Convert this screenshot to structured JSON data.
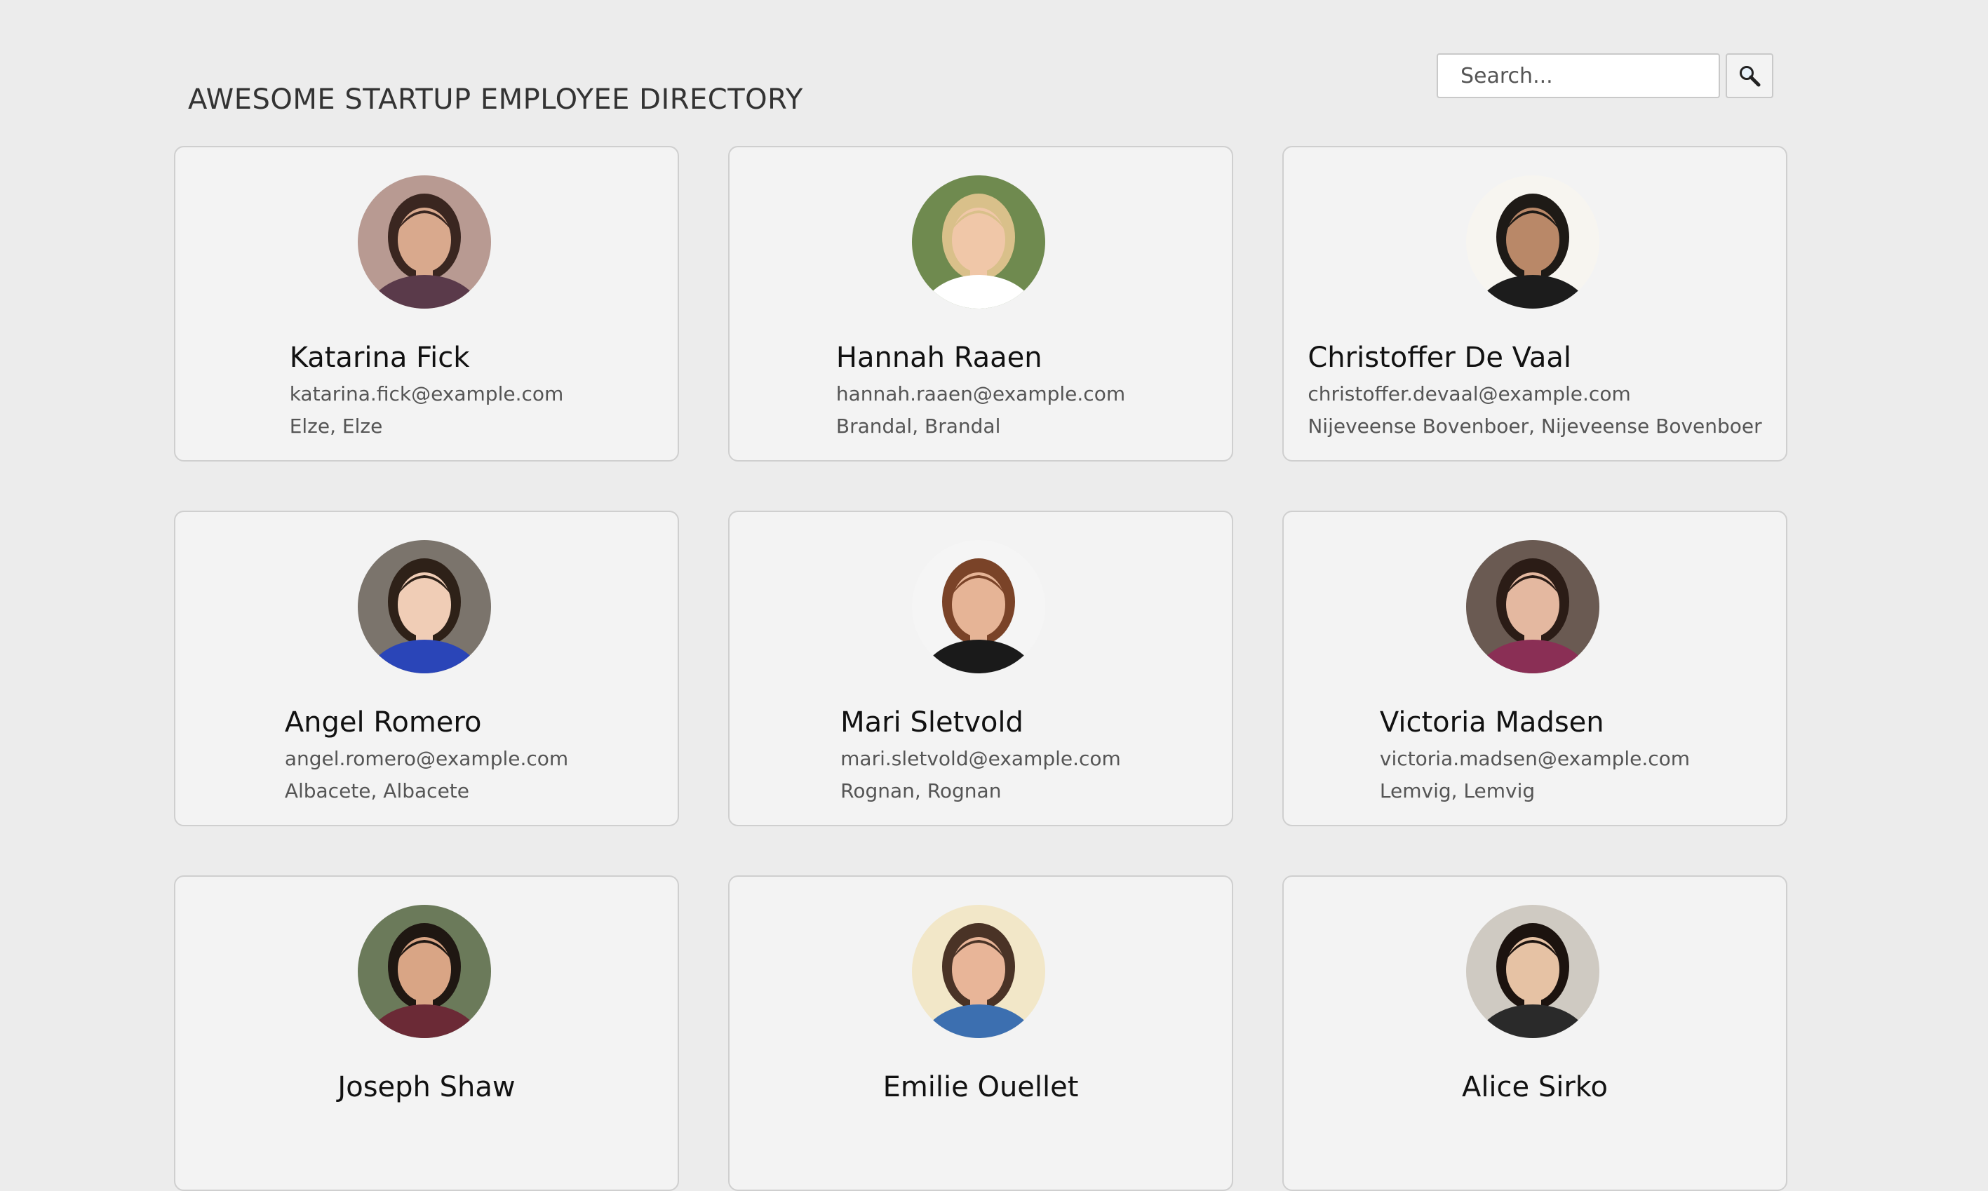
{
  "header": {
    "title": "AWESOME STARTUP EMPLOYEE DIRECTORY",
    "search_placeholder": "Search...",
    "search_icon": "magnifier-icon"
  },
  "employees": [
    {
      "name": "Katarina Fick",
      "email": "katarina.fick@example.com",
      "location": "Elze, Elze"
    },
    {
      "name": "Hannah Raaen",
      "email": "hannah.raaen@example.com",
      "location": "Brandal, Brandal"
    },
    {
      "name": "Christoffer De Vaal",
      "email": "christoffer.devaal@example.com",
      "location": "Nijeveense Bovenboer, Nijeveense Bovenboer"
    },
    {
      "name": "Angel Romero",
      "email": "angel.romero@example.com",
      "location": "Albacete, Albacete"
    },
    {
      "name": "Mari Sletvold",
      "email": "mari.sletvold@example.com",
      "location": "Rognan, Rognan"
    },
    {
      "name": "Victoria Madsen",
      "email": "victoria.madsen@example.com",
      "location": "Lemvig, Lemvig"
    },
    {
      "name": "Joseph Shaw",
      "email": "",
      "location": ""
    },
    {
      "name": "Emilie Ouellet",
      "email": "",
      "location": ""
    },
    {
      "name": "Alice Sirko",
      "email": "",
      "location": ""
    }
  ],
  "avatars": [
    {
      "bg": "#b89a92",
      "skin": "#d9a98d",
      "hair": "#3a2620",
      "shirt": "#5a3a4a"
    },
    {
      "bg": "#6f8a4f",
      "skin": "#f0c7a8",
      "hair": "#d9c08a",
      "shirt": "#ffffff"
    },
    {
      "bg": "#f7f5f0",
      "skin": "#b98868",
      "hair": "#1e1a16",
      "shirt": "#1c1c1c"
    },
    {
      "bg": "#7b746c",
      "skin": "#f0cdb6",
      "hair": "#2e2118",
      "shirt": "#2a45b8"
    },
    {
      "bg": "#f5f5f5",
      "skin": "#e6b496",
      "hair": "#7a4328",
      "shirt": "#1a1a1a"
    },
    {
      "bg": "#6a5a52",
      "skin": "#e4b8a0",
      "hair": "#2b1c16",
      "shirt": "#8a2f55"
    },
    {
      "bg": "#6b7a5a",
      "skin": "#d9a585",
      "hair": "#1f1712",
      "shirt": "#6b2a36"
    },
    {
      "bg": "#f2e7c8",
      "skin": "#e8b598",
      "hair": "#4a3326",
      "shirt": "#3c6fb0"
    },
    {
      "bg": "#cfcac2",
      "skin": "#e6c2a4",
      "hair": "#1c130f",
      "shirt": "#2a2a2a"
    }
  ]
}
